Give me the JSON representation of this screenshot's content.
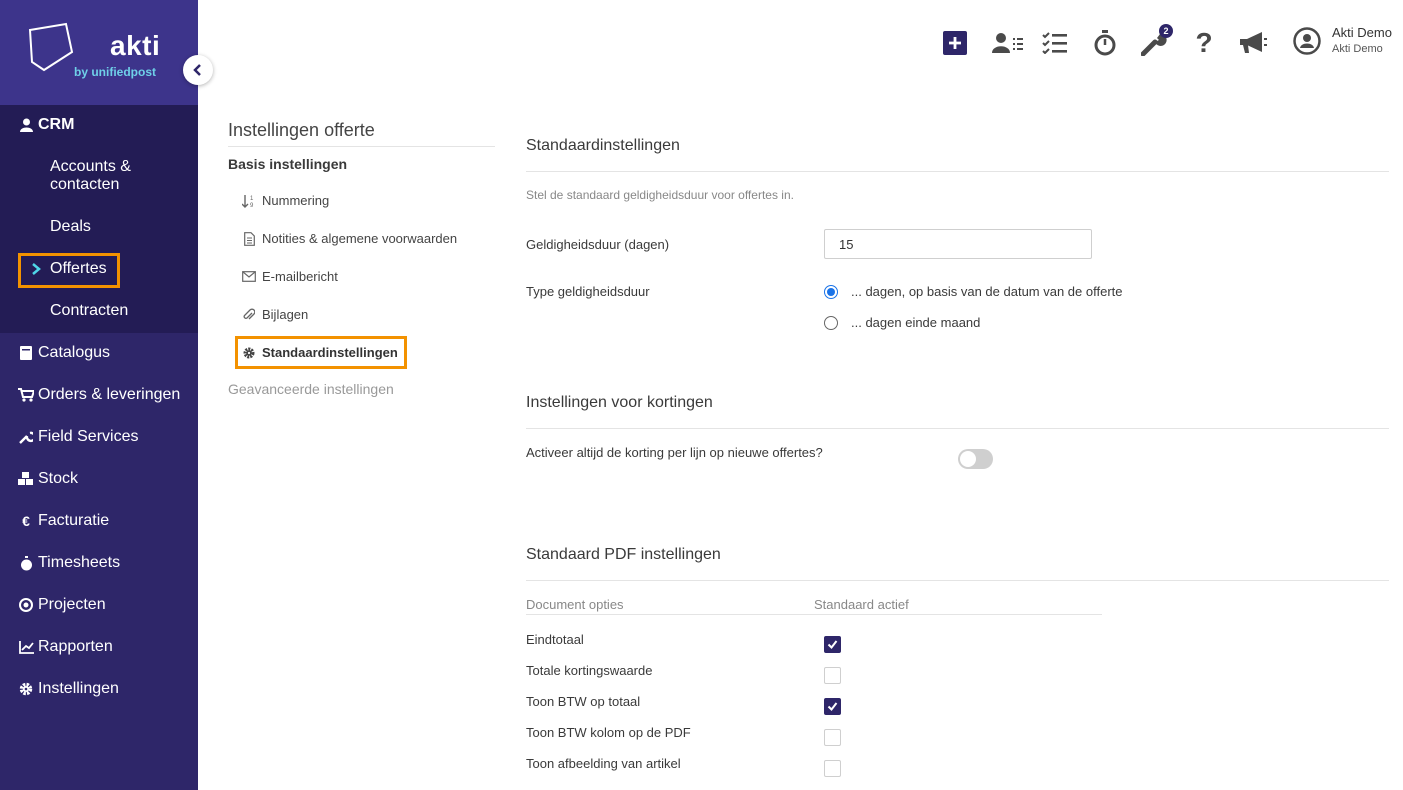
{
  "brand": {
    "name": "akti",
    "sub": "by unifiedpost"
  },
  "sidebar": {
    "crm": "CRM",
    "crm_items": [
      "Accounts &",
      "contacten",
      "Deals",
      "Offertes",
      "Contracten"
    ],
    "items": [
      {
        "label": "Catalogus",
        "icon": "book-icon"
      },
      {
        "label": "Orders & leveringen",
        "icon": "cart-icon"
      },
      {
        "label": "Field Services",
        "icon": "wrench-icon"
      },
      {
        "label": "Stock",
        "icon": "boxes-icon"
      },
      {
        "label": "Facturatie",
        "icon": "euro-icon"
      },
      {
        "label": "Timesheets",
        "icon": "stopwatch-icon"
      },
      {
        "label": "Projecten",
        "icon": "target-icon"
      },
      {
        "label": "Rapporten",
        "icon": "chart-icon"
      },
      {
        "label": "Instellingen",
        "icon": "gear-icon"
      }
    ]
  },
  "topbar": {
    "notification_count": "2",
    "user_name": "Akti Demo",
    "user_company": "Akti Demo"
  },
  "settings_nav": {
    "title": "Instellingen offerte",
    "section": "Basis instellingen",
    "items": [
      "Nummering",
      "Notities & algemene voorwaarden",
      "E-mailbericht",
      "Bijlagen",
      "Standaardinstellingen"
    ],
    "advanced": "Geavanceerde instellingen"
  },
  "main": {
    "defaults_title": "Standaardinstellingen",
    "defaults_desc": "Stel de standaard geldigheidsduur voor offertes in.",
    "validity_label": "Geldigheidsduur (dagen)",
    "validity_value": "15",
    "type_label": "Type geldigheidsduur",
    "type_options": [
      {
        "label": "... dagen, op basis van de datum van de offerte",
        "selected": true
      },
      {
        "label": "... dagen einde maand",
        "selected": false
      }
    ],
    "discount_title": "Instellingen voor kortingen",
    "discount_label": "Activeer altijd de korting per lijn op nieuwe offertes?",
    "discount_enabled": false,
    "pdf_title": "Standaard PDF instellingen",
    "pdf_col_option": "Document opties",
    "pdf_col_active": "Standaard actief",
    "pdf_rows": [
      {
        "label": "Eindtotaal",
        "checked": true
      },
      {
        "label": "Totale kortingswaarde",
        "checked": false
      },
      {
        "label": "Toon BTW op totaal",
        "checked": true
      },
      {
        "label": "Toon BTW kolom op de PDF",
        "checked": false
      },
      {
        "label": "Toon afbeelding van artikel",
        "checked": false
      }
    ]
  }
}
